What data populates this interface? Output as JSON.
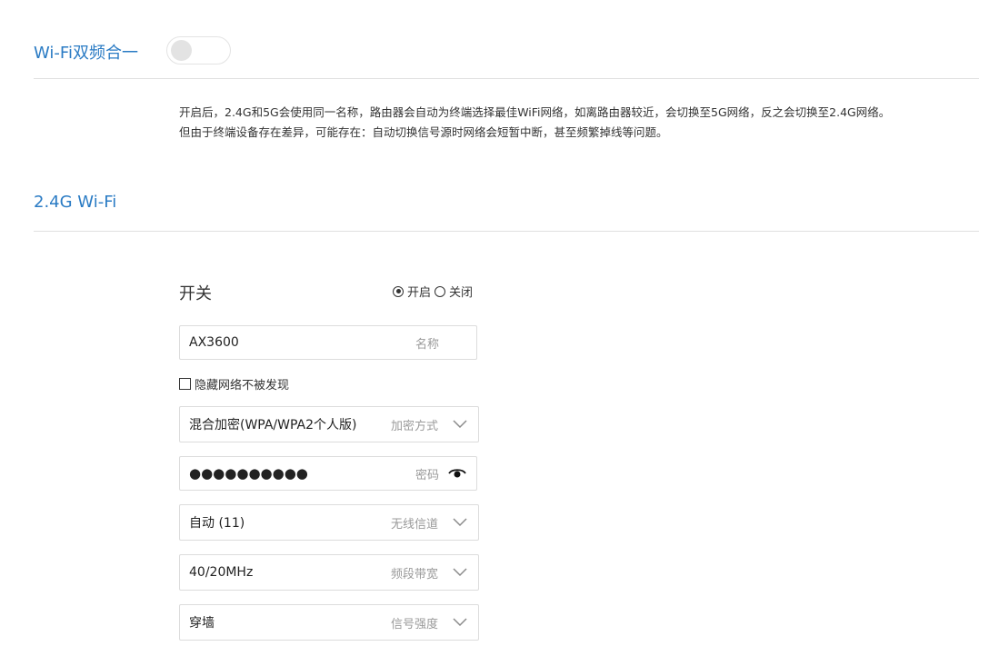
{
  "dual_band": {
    "title": "Wi-Fi双频合一",
    "enabled": false,
    "description_lines": [
      "开启后，2.4G和5G会使用同一名称，路由器会自动为终端选择最佳WiFi网络，如离路由器较近，会切换至5G网络，反之会切换至2.4G网络。",
      "但由于终端设备存在差异，可能存在：自动切换信号源时网络会短暂中断，甚至频繁掉线等问题。"
    ]
  },
  "wifi_24g": {
    "title": "2.4G Wi-Fi",
    "switch_label": "开关",
    "switch_on_label": "开启",
    "switch_off_label": "关闭",
    "switch_state": "on",
    "ssid": {
      "value": "AX3600",
      "hint": "名称"
    },
    "hide_network": {
      "label": "隐藏网络不被发现",
      "checked": false
    },
    "encryption": {
      "value": "混合加密(WPA/WPA2个人版)",
      "hint": "加密方式"
    },
    "password": {
      "value": "●●●●●●●●●●",
      "hint": "密码"
    },
    "channel": {
      "value": "自动 (11)",
      "hint": "无线信道"
    },
    "bandwidth": {
      "value": "40/20MHz",
      "hint": "频段带宽"
    },
    "signal_strength": {
      "value": "穿墙",
      "hint": "信号强度"
    }
  },
  "colors": {
    "accent": "#2a7bc4",
    "divider": "#e0e0e0",
    "hint": "#9a9a9a"
  }
}
